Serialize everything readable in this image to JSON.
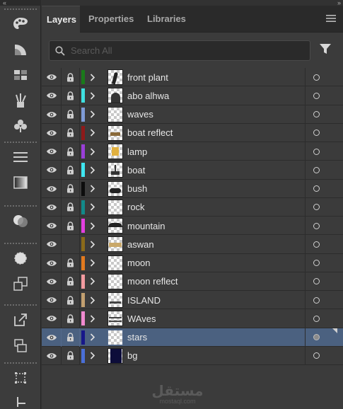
{
  "collapse_glyph": "«",
  "panel_collapse_glyph": "»",
  "tabs": [
    {
      "label": "Layers",
      "active": true
    },
    {
      "label": "Properties",
      "active": false
    },
    {
      "label": "Libraries",
      "active": false
    }
  ],
  "search": {
    "placeholder": "Search All",
    "value": ""
  },
  "toolstrip": {
    "icons": [
      "palette-icon",
      "gradient-swatch-icon",
      "swatches-grid-icon",
      "brushes-icon",
      "symbols-icon",
      "stroke-lines-icon",
      "gradient-icon",
      "transparency-icon",
      "appearance-icon",
      "graphic-styles-icon",
      "export-icon",
      "artboards-icon",
      "align-icon",
      "transform-icon"
    ]
  },
  "layers": [
    {
      "name": "front plant",
      "color": "#1a7a1a",
      "visible": true,
      "locked": true,
      "selected": false
    },
    {
      "name": "abo alhwa",
      "color": "#3fe0e0",
      "visible": true,
      "locked": true,
      "selected": false
    },
    {
      "name": "waves",
      "color": "#7f9bd6",
      "visible": true,
      "locked": true,
      "selected": false
    },
    {
      "name": "boat reflect",
      "color": "#8e1a1a",
      "visible": true,
      "locked": true,
      "selected": false
    },
    {
      "name": "lamp",
      "color": "#9a3fd8",
      "visible": true,
      "locked": true,
      "selected": false
    },
    {
      "name": "boat",
      "color": "#3fe6f0",
      "visible": true,
      "locked": true,
      "selected": false
    },
    {
      "name": " bush",
      "color": "#0d0d0d",
      "visible": true,
      "locked": true,
      "selected": false
    },
    {
      "name": "rock",
      "color": "#128a8a",
      "visible": true,
      "locked": true,
      "selected": false
    },
    {
      "name": "mountain",
      "color": "#e33fe0",
      "visible": true,
      "locked": true,
      "selected": false
    },
    {
      "name": "aswan",
      "color": "#8a6a1a",
      "visible": true,
      "locked": false,
      "selected": false
    },
    {
      "name": "moon",
      "color": "#e27a1f",
      "visible": true,
      "locked": true,
      "selected": false
    },
    {
      "name": "moon reflect",
      "color": "#f19aa0",
      "visible": true,
      "locked": true,
      "selected": false
    },
    {
      "name": "ISLAND",
      "color": "#c2a070",
      "visible": true,
      "locked": true,
      "selected": false
    },
    {
      "name": "WAves",
      "color": "#f08ad0",
      "visible": true,
      "locked": true,
      "selected": false
    },
    {
      "name": "stars",
      "color": "#17178a",
      "visible": true,
      "locked": true,
      "selected": true
    },
    {
      "name": "bg",
      "color": "#4a6fd8",
      "visible": true,
      "locked": true,
      "selected": false
    }
  ],
  "watermark": {
    "main": "مستقل",
    "sub": "mostaql.com"
  }
}
